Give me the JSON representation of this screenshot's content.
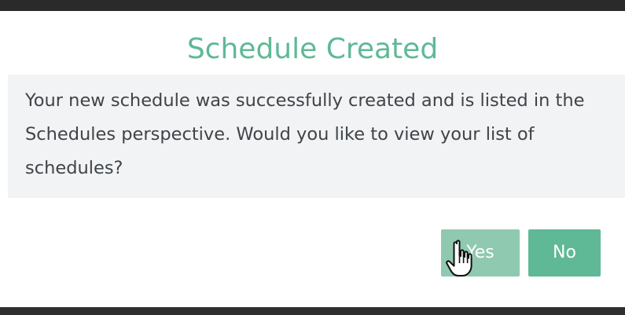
{
  "dialog": {
    "title": "Schedule Created",
    "message": "Your new schedule was successfully created and is listed in the Schedules perspective. Would you like to view your list of schedules?",
    "yes_label": "Yes",
    "no_label": "No"
  },
  "colors": {
    "accent": "#5fb996",
    "button_hover": "#8fc9b0",
    "message_background": "#f2f3f5",
    "text": "#3f4448"
  },
  "icons": {
    "cursor": "hand-pointer-icon"
  }
}
